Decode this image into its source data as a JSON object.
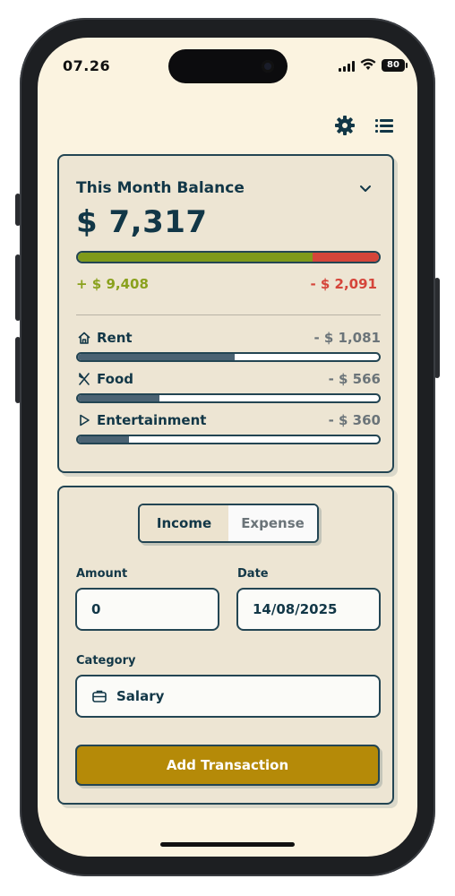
{
  "status_bar": {
    "time": "07.26",
    "battery": "80"
  },
  "balance": {
    "title": "This Month Balance",
    "amount": "$ 7,317",
    "income_text": "+ $ 9,408",
    "expense_text": "- $ 2,091",
    "income_share": 0.78,
    "colors": {
      "income": "#7f9a1a",
      "expense": "#d5453a"
    },
    "categories": [
      {
        "label": "Rent",
        "amount": "- $ 1,081",
        "icon": "home-icon",
        "fraction": 0.52
      },
      {
        "label": "Food",
        "amount": "- $ 566",
        "icon": "fork-knife-icon",
        "fraction": 0.27
      },
      {
        "label": "Entertainment",
        "amount": "- $ 360",
        "icon": "play-icon",
        "fraction": 0.17
      }
    ]
  },
  "form": {
    "tabs": {
      "income": "Income",
      "expense": "Expense",
      "selected": "Income"
    },
    "amount_label": "Amount",
    "amount_value": "0",
    "date_label": "Date",
    "date_value": "14/08/2025",
    "category_label": "Category",
    "category_value": "Salary",
    "category_icon": "briefcase-icon",
    "submit_label": "Add Transaction",
    "accent": "#b58a08"
  }
}
